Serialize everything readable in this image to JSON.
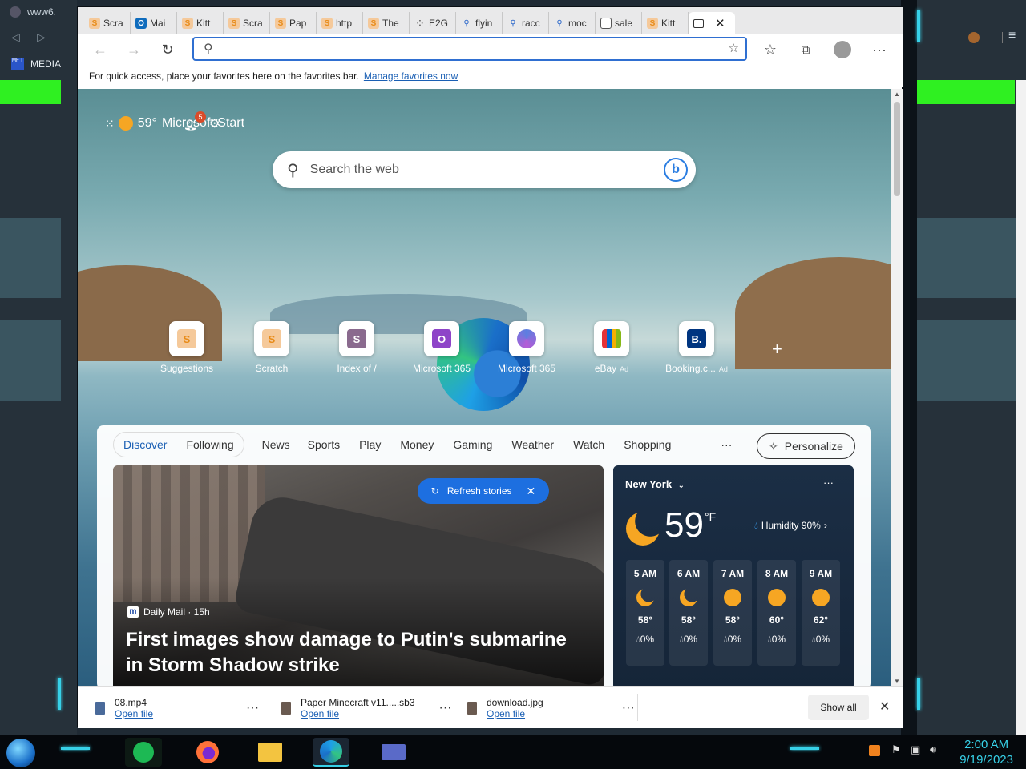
{
  "desktop": {
    "top_left_label": "www6.",
    "media_label": "MEDIA",
    "media_badge": "MF T"
  },
  "browser": {
    "tabs": [
      {
        "label": "Scra",
        "icon": "scratch-icon"
      },
      {
        "label": "Mai",
        "icon": "outlook-icon"
      },
      {
        "label": "Kitt",
        "icon": "scratch-icon"
      },
      {
        "label": "Scra",
        "icon": "scratch-icon"
      },
      {
        "label": "Pap",
        "icon": "scratch-icon"
      },
      {
        "label": "http",
        "icon": "scratch-icon"
      },
      {
        "label": "The",
        "icon": "scratch-icon"
      },
      {
        "label": "E2G",
        "icon": "loading-icon"
      },
      {
        "label": "flyin",
        "icon": "search-icon"
      },
      {
        "label": "racc",
        "icon": "search-icon"
      },
      {
        "label": "moc",
        "icon": "search-icon"
      },
      {
        "label": "sale",
        "icon": "document-icon"
      },
      {
        "label": "Kitt",
        "icon": "scratch-icon"
      }
    ],
    "address_value": "",
    "favorites_bar": {
      "text": "For quick access, place your favorites here on the favorites bar.",
      "link": "Manage favorites now"
    }
  },
  "ntp": {
    "temperature_short": "59°",
    "brand": "Microsoft Start",
    "notification_count": "5",
    "search_placeholder": "Search the web",
    "quick_links": [
      {
        "label": "Suggestions",
        "letter": "",
        "color": "#f5c99a",
        "ad": ""
      },
      {
        "label": "Scratch",
        "letter": "",
        "color": "#f5c99a",
        "ad": ""
      },
      {
        "label": "Index of /",
        "letter": "S",
        "color": "#8a6a8e",
        "ad": ""
      },
      {
        "label": "Microsoft 365",
        "letter": "O",
        "color": "#8e44c8",
        "ad": ""
      },
      {
        "label": "Microsoft 365",
        "letter": "",
        "color": "#5b7fe0",
        "ad": ""
      },
      {
        "label": "eBay",
        "letter": "",
        "color": "#e53238",
        "ad": "Ad"
      },
      {
        "label": "Booking.c...",
        "letter": "B.",
        "color": "#003580",
        "ad": "Ad"
      }
    ],
    "feed_nav": {
      "discover": "Discover",
      "following": "Following",
      "items": [
        "News",
        "Sports",
        "Play",
        "Money",
        "Gaming",
        "Weather",
        "Watch",
        "Shopping"
      ],
      "more": "···",
      "personalize": "Personalize"
    },
    "hero": {
      "refresh": "Refresh stories",
      "source": "Daily Mail · 15h",
      "source_badge": "m",
      "headline": "First images show damage to Putin's submarine in Storm Shadow strike"
    },
    "weather": {
      "location": "New York",
      "more": "···",
      "temp": "59",
      "unit": "°F",
      "humidity": "Humidity 90%",
      "hours": [
        {
          "time": "5 AM",
          "temp": "58°",
          "precip": "0%",
          "icon": "moon"
        },
        {
          "time": "6 AM",
          "temp": "58°",
          "precip": "0%",
          "icon": "moon"
        },
        {
          "time": "7 AM",
          "temp": "58°",
          "precip": "0%",
          "icon": "sun"
        },
        {
          "time": "8 AM",
          "temp": "60°",
          "precip": "0%",
          "icon": "sun"
        },
        {
          "time": "9 AM",
          "temp": "62°",
          "precip": "0%",
          "icon": "sun"
        }
      ]
    }
  },
  "downloads": {
    "items": [
      {
        "name": "08.mp4",
        "action": "Open file"
      },
      {
        "name": "Paper Minecraft v11.....sb3",
        "action": "Open file"
      },
      {
        "name": "download.jpg",
        "action": "Open file"
      }
    ],
    "show_all": "Show all"
  },
  "taskbar": {
    "time": "2:00 AM",
    "date": "9/19/2023"
  }
}
